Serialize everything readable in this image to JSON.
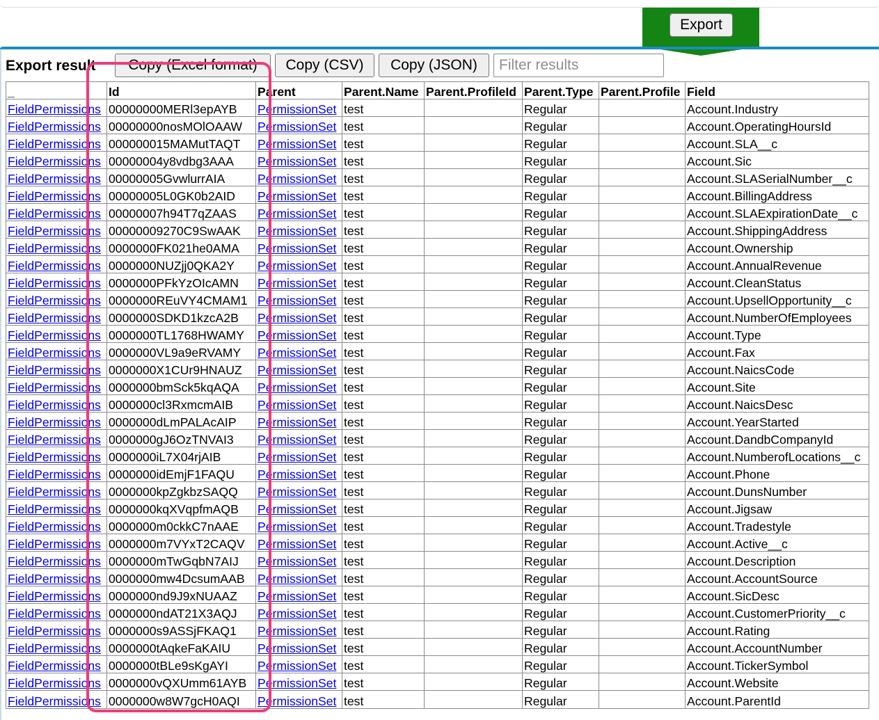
{
  "header": {
    "export_button": "Export"
  },
  "toolbar": {
    "label": "Export result",
    "copy_excel": "Copy (Excel format)",
    "copy_csv": "Copy (CSV)",
    "copy_json": "Copy (JSON)",
    "filter_placeholder": "Filter results"
  },
  "colors": {
    "banner_green": "#148414",
    "accent_blue": "#1a8fc0",
    "highlight_pink": "#ec3d7a",
    "link_blue": "#0000ee"
  },
  "table": {
    "columns": [
      "_",
      "Id",
      "Parent",
      "Parent.Name",
      "Parent.ProfileId",
      "Parent.Type",
      "Parent.Profile",
      "Field"
    ],
    "rows": [
      {
        "type": "FieldPermissions",
        "id": "00000000MERl3epAYB",
        "parent": "PermissionSet",
        "name": "test",
        "profile_id": "",
        "ptype": "Regular",
        "profile": "",
        "field": "Account.Industry"
      },
      {
        "type": "FieldPermissions",
        "id": "00000000nosMOlOAAW",
        "parent": "PermissionSet",
        "name": "test",
        "profile_id": "",
        "ptype": "Regular",
        "profile": "",
        "field": "Account.OperatingHoursId"
      },
      {
        "type": "FieldPermissions",
        "id": "000000015MAMutTAQT",
        "parent": "PermissionSet",
        "name": "test",
        "profile_id": "",
        "ptype": "Regular",
        "profile": "",
        "field": "Account.SLA__c"
      },
      {
        "type": "FieldPermissions",
        "id": "00000004y8vdbg3AAA",
        "parent": "PermissionSet",
        "name": "test",
        "profile_id": "",
        "ptype": "Regular",
        "profile": "",
        "field": "Account.Sic"
      },
      {
        "type": "FieldPermissions",
        "id": "00000005GvwlurrAIA",
        "parent": "PermissionSet",
        "name": "test",
        "profile_id": "",
        "ptype": "Regular",
        "profile": "",
        "field": "Account.SLASerialNumber__c"
      },
      {
        "type": "FieldPermissions",
        "id": "00000005L0GK0b2AID",
        "parent": "PermissionSet",
        "name": "test",
        "profile_id": "",
        "ptype": "Regular",
        "profile": "",
        "field": "Account.BillingAddress"
      },
      {
        "type": "FieldPermissions",
        "id": "00000007h94T7qZAAS",
        "parent": "PermissionSet",
        "name": "test",
        "profile_id": "",
        "ptype": "Regular",
        "profile": "",
        "field": "Account.SLAExpirationDate__c"
      },
      {
        "type": "FieldPermissions",
        "id": "00000009270C9SwAAK",
        "parent": "PermissionSet",
        "name": "test",
        "profile_id": "",
        "ptype": "Regular",
        "profile": "",
        "field": "Account.ShippingAddress"
      },
      {
        "type": "FieldPermissions",
        "id": "0000000FK021he0AMA",
        "parent": "PermissionSet",
        "name": "test",
        "profile_id": "",
        "ptype": "Regular",
        "profile": "",
        "field": "Account.Ownership"
      },
      {
        "type": "FieldPermissions",
        "id": "0000000NUZjj0QKA2Y",
        "parent": "PermissionSet",
        "name": "test",
        "profile_id": "",
        "ptype": "Regular",
        "profile": "",
        "field": "Account.AnnualRevenue"
      },
      {
        "type": "FieldPermissions",
        "id": "0000000PFkYzOIcAMN",
        "parent": "PermissionSet",
        "name": "test",
        "profile_id": "",
        "ptype": "Regular",
        "profile": "",
        "field": "Account.CleanStatus"
      },
      {
        "type": "FieldPermissions",
        "id": "0000000REuVY4CMAM1",
        "parent": "PermissionSet",
        "name": "test",
        "profile_id": "",
        "ptype": "Regular",
        "profile": "",
        "field": "Account.UpsellOpportunity__c"
      },
      {
        "type": "FieldPermissions",
        "id": "0000000SDKD1kzcA2B",
        "parent": "PermissionSet",
        "name": "test",
        "profile_id": "",
        "ptype": "Regular",
        "profile": "",
        "field": "Account.NumberOfEmployees"
      },
      {
        "type": "FieldPermissions",
        "id": "0000000TL1768HWAMY",
        "parent": "PermissionSet",
        "name": "test",
        "profile_id": "",
        "ptype": "Regular",
        "profile": "",
        "field": "Account.Type"
      },
      {
        "type": "FieldPermissions",
        "id": "0000000VL9a9eRVAMY",
        "parent": "PermissionSet",
        "name": "test",
        "profile_id": "",
        "ptype": "Regular",
        "profile": "",
        "field": "Account.Fax"
      },
      {
        "type": "FieldPermissions",
        "id": "0000000X1CUr9HNAUZ",
        "parent": "PermissionSet",
        "name": "test",
        "profile_id": "",
        "ptype": "Regular",
        "profile": "",
        "field": "Account.NaicsCode"
      },
      {
        "type": "FieldPermissions",
        "id": "0000000bmSck5kqAQA",
        "parent": "PermissionSet",
        "name": "test",
        "profile_id": "",
        "ptype": "Regular",
        "profile": "",
        "field": "Account.Site"
      },
      {
        "type": "FieldPermissions",
        "id": "0000000cl3RxmcmAIB",
        "parent": "PermissionSet",
        "name": "test",
        "profile_id": "",
        "ptype": "Regular",
        "profile": "",
        "field": "Account.NaicsDesc"
      },
      {
        "type": "FieldPermissions",
        "id": "0000000dLmPALAcAIP",
        "parent": "PermissionSet",
        "name": "test",
        "profile_id": "",
        "ptype": "Regular",
        "profile": "",
        "field": "Account.YearStarted"
      },
      {
        "type": "FieldPermissions",
        "id": "0000000gJ6OzTNVAI3",
        "parent": "PermissionSet",
        "name": "test",
        "profile_id": "",
        "ptype": "Regular",
        "profile": "",
        "field": "Account.DandbCompanyId"
      },
      {
        "type": "FieldPermissions",
        "id": "0000000iL7X04rjAIB",
        "parent": "PermissionSet",
        "name": "test",
        "profile_id": "",
        "ptype": "Regular",
        "profile": "",
        "field": "Account.NumberofLocations__c"
      },
      {
        "type": "FieldPermissions",
        "id": "0000000idEmjF1FAQU",
        "parent": "PermissionSet",
        "name": "test",
        "profile_id": "",
        "ptype": "Regular",
        "profile": "",
        "field": "Account.Phone"
      },
      {
        "type": "FieldPermissions",
        "id": "0000000kpZgkbzSAQQ",
        "parent": "PermissionSet",
        "name": "test",
        "profile_id": "",
        "ptype": "Regular",
        "profile": "",
        "field": "Account.DunsNumber"
      },
      {
        "type": "FieldPermissions",
        "id": "0000000kqXVqpfmAQB",
        "parent": "PermissionSet",
        "name": "test",
        "profile_id": "",
        "ptype": "Regular",
        "profile": "",
        "field": "Account.Jigsaw"
      },
      {
        "type": "FieldPermissions",
        "id": "0000000m0ckkC7nAAE",
        "parent": "PermissionSet",
        "name": "test",
        "profile_id": "",
        "ptype": "Regular",
        "profile": "",
        "field": "Account.Tradestyle"
      },
      {
        "type": "FieldPermissions",
        "id": "0000000m7VYxT2CAQV",
        "parent": "PermissionSet",
        "name": "test",
        "profile_id": "",
        "ptype": "Regular",
        "profile": "",
        "field": "Account.Active__c"
      },
      {
        "type": "FieldPermissions",
        "id": "0000000mTwGqbN7AIJ",
        "parent": "PermissionSet",
        "name": "test",
        "profile_id": "",
        "ptype": "Regular",
        "profile": "",
        "field": "Account.Description"
      },
      {
        "type": "FieldPermissions",
        "id": "0000000mw4DcsumAAB",
        "parent": "PermissionSet",
        "name": "test",
        "profile_id": "",
        "ptype": "Regular",
        "profile": "",
        "field": "Account.AccountSource"
      },
      {
        "type": "FieldPermissions",
        "id": "0000000nd9J9xNUAAZ",
        "parent": "PermissionSet",
        "name": "test",
        "profile_id": "",
        "ptype": "Regular",
        "profile": "",
        "field": "Account.SicDesc"
      },
      {
        "type": "FieldPermissions",
        "id": "0000000ndAT21X3AQJ",
        "parent": "PermissionSet",
        "name": "test",
        "profile_id": "",
        "ptype": "Regular",
        "profile": "",
        "field": "Account.CustomerPriority__c"
      },
      {
        "type": "FieldPermissions",
        "id": "0000000s9ASSjFKAQ1",
        "parent": "PermissionSet",
        "name": "test",
        "profile_id": "",
        "ptype": "Regular",
        "profile": "",
        "field": "Account.Rating"
      },
      {
        "type": "FieldPermissions",
        "id": "0000000tAqkeFaKAIU",
        "parent": "PermissionSet",
        "name": "test",
        "profile_id": "",
        "ptype": "Regular",
        "profile": "",
        "field": "Account.AccountNumber"
      },
      {
        "type": "FieldPermissions",
        "id": "0000000tBLe9sKgAYI",
        "parent": "PermissionSet",
        "name": "test",
        "profile_id": "",
        "ptype": "Regular",
        "profile": "",
        "field": "Account.TickerSymbol"
      },
      {
        "type": "FieldPermissions",
        "id": "0000000vQXUmm61AYB",
        "parent": "PermissionSet",
        "name": "test",
        "profile_id": "",
        "ptype": "Regular",
        "profile": "",
        "field": "Account.Website"
      },
      {
        "type": "FieldPermissions",
        "id": "0000000w8W7gcH0AQI",
        "parent": "PermissionSet",
        "name": "test",
        "profile_id": "",
        "ptype": "Regular",
        "profile": "",
        "field": "Account.ParentId"
      }
    ]
  }
}
